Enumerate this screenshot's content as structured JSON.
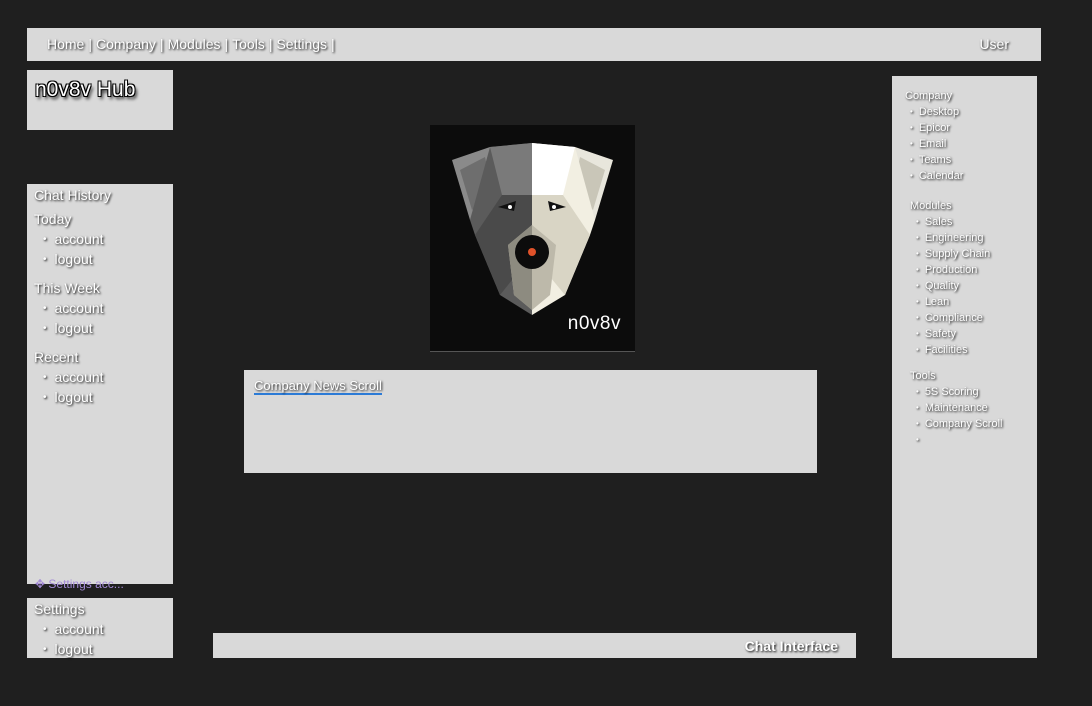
{
  "nav": {
    "links": [
      "Home",
      "Company",
      "Modules",
      "Tools",
      "Settings"
    ],
    "separator": "|",
    "user": "User"
  },
  "hub": {
    "title": "n0v8v Hub"
  },
  "history": {
    "title": "Chat History",
    "groups": [
      {
        "label": "Today",
        "items": [
          "account",
          "logout"
        ]
      },
      {
        "label": "This Week",
        "items": [
          "account",
          "logout"
        ]
      },
      {
        "label": "Recent",
        "items": [
          "account",
          "logout"
        ]
      }
    ]
  },
  "settings_acc": {
    "icon": "gear-icon",
    "label": "Settings acc..."
  },
  "settings": {
    "title": "Settings",
    "items": [
      "account",
      "logout"
    ]
  },
  "logo": {
    "brand": "n0v8v",
    "accent": "#e0522a"
  },
  "news": {
    "title": "Company News Scroll"
  },
  "chat": {
    "label": "Chat Interface"
  },
  "right": {
    "company": {
      "label": "Company",
      "items": [
        "Desktop",
        "Epicor",
        "Email",
        "Teams",
        "Calendar"
      ]
    },
    "modules": {
      "label": "Modules",
      "items": [
        "Sales",
        "Engineering",
        "Supply Chain",
        "Production",
        "Quality",
        "Lean",
        "Compliance",
        "Safety",
        "Facilities"
      ]
    },
    "tools": {
      "label": "Tools",
      "items": [
        "5S Scoring",
        "Maintenance",
        "Company Scroll",
        ""
      ]
    }
  }
}
